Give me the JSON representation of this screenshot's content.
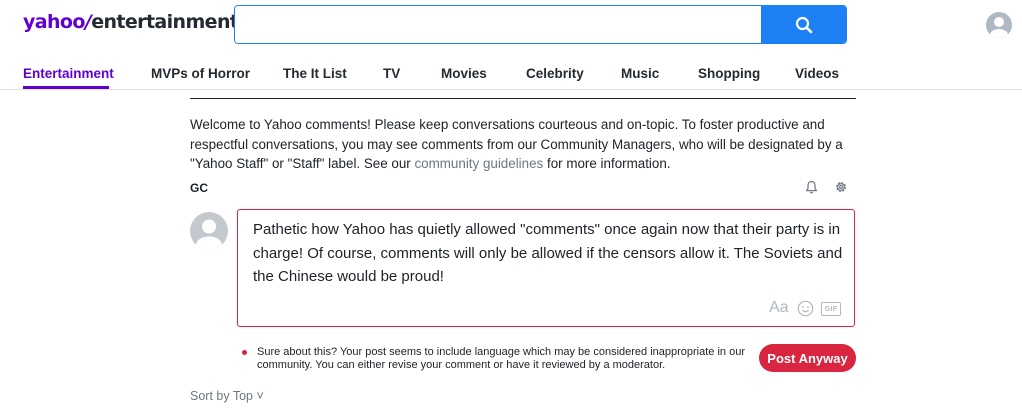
{
  "header": {
    "logo_brand": "yahoo",
    "logo_slash": "/",
    "logo_section": "entertainment",
    "search_value": "",
    "search_placeholder": ""
  },
  "nav": {
    "items": [
      {
        "label": "Entertainment",
        "active": true
      },
      {
        "label": "MVPs of Horror"
      },
      {
        "label": "The It List"
      },
      {
        "label": "TV"
      },
      {
        "label": "Movies"
      },
      {
        "label": "Celebrity"
      },
      {
        "label": "Music"
      },
      {
        "label": "Shopping"
      },
      {
        "label": "Videos"
      }
    ]
  },
  "comments": {
    "welcome_before": "Welcome to Yahoo comments! Please keep conversations courteous and on-topic. To foster productive and respectful conversations, you may see comments from our Community Managers, who will be designated by a \"Yahoo Staff\" or \"Staff\" label. See our ",
    "welcome_link": "community guidelines",
    "welcome_after": " for more information.",
    "user_initials": "GC",
    "draft_text": "Pathetic how Yahoo has quietly allowed \"comments\" once again now that their party is in charge!  Of course, comments will only be allowed if the censors allow it.  The Soviets and the Chinese would be proud!",
    "tools": {
      "font": "Aa",
      "gif": "GIF"
    },
    "warning_text": "Sure about this? Your post seems to include language which may be considered inappropriate in our community. You can either revise your comment or have it reviewed by a moderator.",
    "post_anyway_label": "Post Anyway",
    "sort_prefix": "Sort by ",
    "sort_value": "Top",
    "sort_chevron": "˅"
  },
  "colors": {
    "brand_purple": "#6001d2",
    "search_blue": "#1d80f5",
    "alert_red": "#d9253f",
    "muted_gray": "#6e7780"
  },
  "icons": {
    "search": "search-icon",
    "profile": "user-avatar-icon",
    "notification": "bell-icon",
    "settings": "gear-icon",
    "emoji": "smiley-icon",
    "gif": "gif-icon"
  }
}
